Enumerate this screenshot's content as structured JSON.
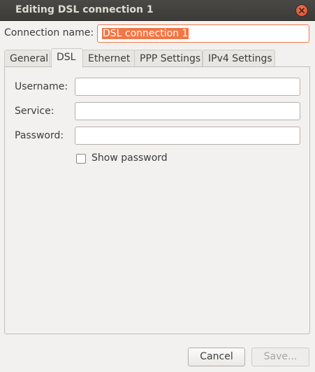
{
  "window": {
    "title": "Editing DSL connection 1"
  },
  "connection": {
    "label": "Connection name:",
    "value": "DSL connection 1"
  },
  "tabs": [
    {
      "label": "General"
    },
    {
      "label": "DSL"
    },
    {
      "label": "Ethernet"
    },
    {
      "label": "PPP Settings"
    },
    {
      "label": "IPv4 Settings"
    }
  ],
  "active_tab": "DSL",
  "form": {
    "username_label": "Username:",
    "username_value": "",
    "service_label": "Service:",
    "service_value": "",
    "password_label": "Password:",
    "password_value": "",
    "show_password_label": "Show password",
    "show_password_checked": false
  },
  "buttons": {
    "cancel": "Cancel",
    "save": "Save..."
  },
  "colors": {
    "accent": "#f07746",
    "titlebar": "#3c3b37"
  }
}
